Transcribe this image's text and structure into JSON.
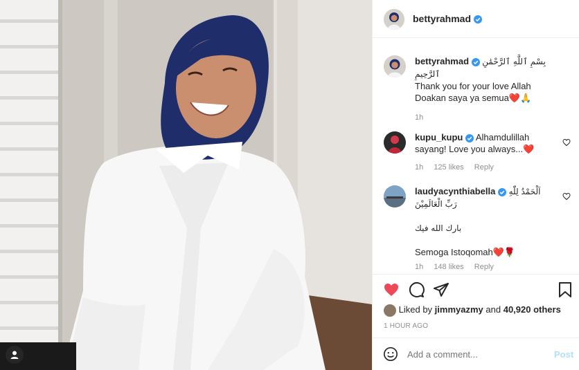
{
  "post": {
    "username": "bettyrahmad",
    "caption_arabic": "بِسْمِ ٱللَّهِ ٱلرَّحْمَٰنِ ٱلرَّحِيمِ",
    "caption_line1": "Thank you for your love Allah",
    "caption_line2": "Doakan saya ya semua",
    "caption_emoji": "❤️🙏",
    "caption_time": "1h"
  },
  "comments": [
    {
      "username": "kupu_kupu",
      "text_a": "Alhamdulillah",
      "text_b": "sayang! Love you always...",
      "emoji": "❤️",
      "time": "1h",
      "likes": "125 likes",
      "reply": "Reply"
    },
    {
      "username": "laudyacynthiabella",
      "text_a": "اَلْحَمْدُ لِلّٰهِ",
      "text_b": "رَبِّ الْعَالَمِيْنَ",
      "text_c": "بارك الله فيك",
      "text_d": "Semoga Istoqomah",
      "emoji": "❤️🌹",
      "time": "1h",
      "likes": "148 likes",
      "reply": "Reply"
    }
  ],
  "likes": {
    "prefix": "Liked by",
    "user": "jimmyazmy",
    "and": "and",
    "count": "40,920 others"
  },
  "timestamp": "1 HOUR AGO",
  "add_comment": {
    "placeholder": "Add a comment...",
    "post_label": "Post"
  },
  "colors": {
    "like_red": "#ed4956",
    "verified_blue": "#3897f0",
    "post_blue": "#b2dffc",
    "hijab_navy": "#1f2e6b"
  }
}
